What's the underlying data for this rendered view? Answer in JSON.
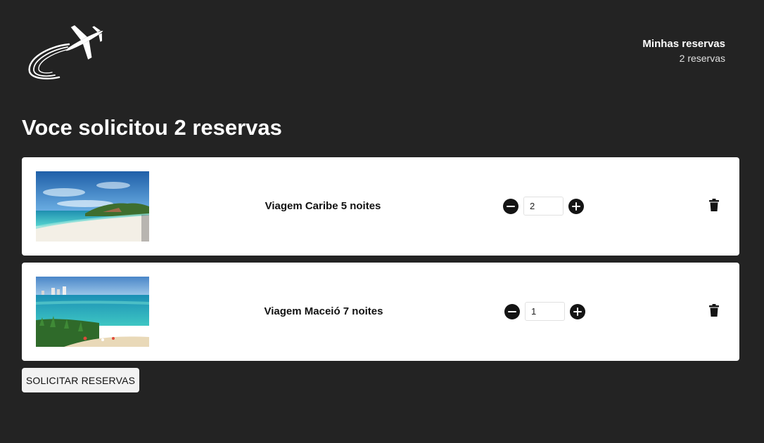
{
  "header": {
    "logo_icon": "airplane-logo-icon",
    "title": "Minhas reservas",
    "count": "2 reservas"
  },
  "page": {
    "title": "Voce solicitou 2 reservas"
  },
  "reservations": [
    {
      "name": "Viagem Caribe 5 noites",
      "quantity": "2",
      "image": "beach-caribe-photo"
    },
    {
      "name": "Viagem Maceió 7 noites",
      "quantity": "1",
      "image": "beach-maceio-photo"
    }
  ],
  "icons": {
    "decrease": "minus-circle-icon",
    "increase": "plus-circle-icon",
    "remove": "trash-icon"
  },
  "actions": {
    "submit_label": "SOLICITAR RESERVAS"
  },
  "colors": {
    "background": "#232323",
    "card": "#ffffff",
    "text_dark": "#111111",
    "button_bg": "#f2f2f2"
  }
}
